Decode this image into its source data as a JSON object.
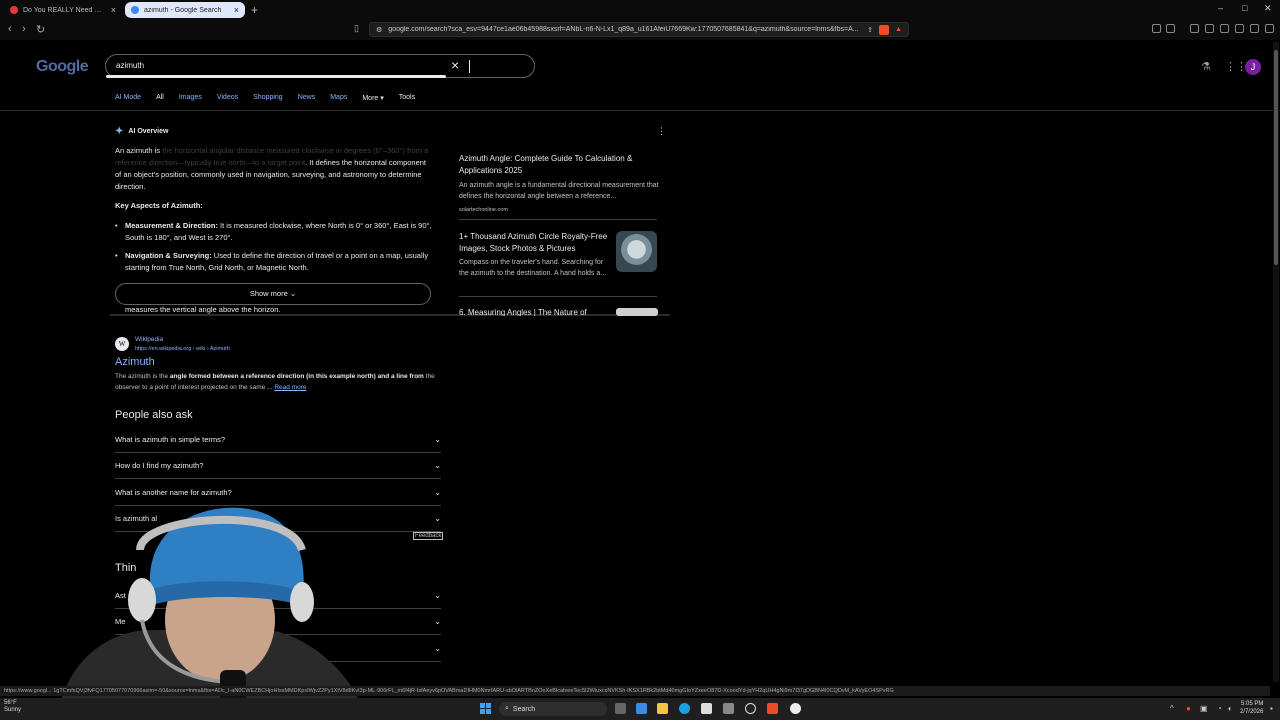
{
  "browser": {
    "tabs": [
      {
        "title": "Do You REALLY Need Rest Days? - Yo",
        "active": false
      },
      {
        "title": "azimuth - Google Search",
        "active": true
      }
    ],
    "url": "google.com/search?sca_esv=9447ce1ae06b45988sxsrf=ANbL-n6-N-Lx1_q89a_u161AfeiU7669Kw:1770507685841&q=azimuth&source=lnms&fbs=A..."
  },
  "google": {
    "logo": "Google",
    "query": "azimuth",
    "avatar_letter": "J",
    "tabs": [
      "AI Mode",
      "All",
      "Images",
      "Videos",
      "Shopping",
      "News",
      "Maps",
      "More",
      "Tools"
    ]
  },
  "ai_overview": {
    "label": "AI Overview",
    "intro": "An azimuth is",
    "intro_faded": "the horizontal angular distance measured clockwise in degrees (0°–360°) from a reference direction—typically true north—to a target point",
    "intro_rest": ". It defines the horizontal component of an object's position, commonly used in navigation, surveying, and astronomy to determine direction.",
    "key_heading": "Key Aspects of Azimuth:",
    "bullets": [
      {
        "title": "Measurement & Direction:",
        "text": " It is measured clockwise, where North is 0° or 360°, East is 90°, South is 180°, and West is 270°."
      },
      {
        "title": "Navigation & Surveying:",
        "text": " Used to define the direction of travel or a point on a map, usually starting from True North, Grid North, or Magnetic North."
      }
    ],
    "cut_line": "measures the vertical angle above the horizon.",
    "show_more": "Show more",
    "sources": [
      {
        "title": "Azimuth Angle: Complete Guide To Calculation & Applications 2025",
        "desc": "An azimuth angle is a fundamental directional measurement that defines the horizontal angle between a reference...",
        "site": "solartechonline.com"
      },
      {
        "title": "1+ Thousand Azimuth Circle Royalty-Free Images, Stock Photos & Pictures",
        "desc": "Compass on the traveler's hand. Searching for the azimuth to the destination. A hand holds a..."
      },
      {
        "title": "6. Measuring Angles | The Nature of"
      }
    ]
  },
  "wiki_result": {
    "icon": "W",
    "site": "Wikipedia",
    "url": "https://en.wikipedia.org › wiki › Azimuth",
    "title": "Azimuth",
    "snippet_pre": "The azimuth is the ",
    "snippet_bold": "angle formed between a reference direction (in this example north) and a line from",
    "snippet_post": " the observer to a point of interest projected on the same ...",
    "read_more": "Read more"
  },
  "people_also_ask": {
    "heading": "People also ask",
    "questions": [
      "What is azimuth in simple terms?",
      "How do I find my azimuth?",
      "What is another name for azimuth?",
      "Is azimuth al"
    ],
    "feedback": "Feedback"
  },
  "things_to_know": {
    "heading": "Thin",
    "rows": [
      "Ast",
      "Me",
      ""
    ]
  },
  "status_url": "https://www.googl... 1gTCmfxQVj3fvFQ17705077070966axim=-50&source=lnms&fbs=ADc_I-aN0CWEZBCHjoHIssMMDKpsIWjvZ2Py1XtV8dIIKvI3p-ML-906rFL_m6f4jR-IsfAeyv6pOVABmaDIHM0NmrfARU-sbOiARTBnZOoXeBlcatveeTec5I2WiuxccNVKSh-IKSX1RBk2btMd40mgGIoYZxeeO87D-XcoodYd-jqYH2qUH4gNi9m7I37gDGBN4I0CQDvM_kAVyEO4SPvRG",
  "taskbar": {
    "weather_temp": "56°F",
    "weather_desc": "Sunny",
    "search_label": "Search",
    "time": "5:05 PM",
    "date": "2/7/2026"
  },
  "colors": {
    "link": "#8ab4f8",
    "background": "#000000",
    "avatar": "#7b1fa2",
    "brave": "#f14b25"
  }
}
